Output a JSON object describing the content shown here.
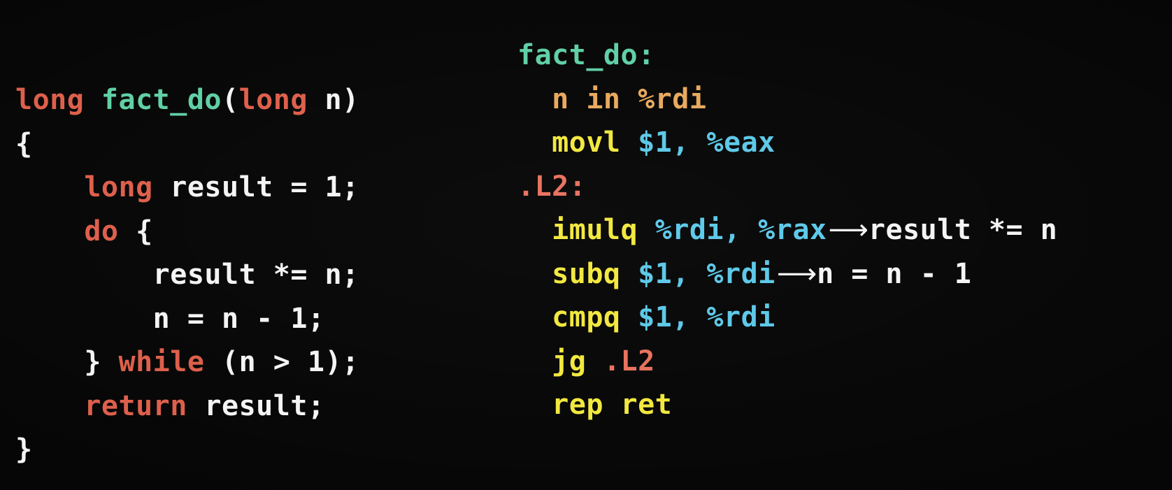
{
  "slide": {
    "background_color": "#050505",
    "palette": {
      "keyword_red": "#dd5e4a",
      "function_green": "#5ecfa4",
      "plain_white": "#f4f4f4",
      "mnemonic_yellow": "#f2e83c",
      "register_cyan": "#5bc8e8",
      "comment_orange": "#e8a85c",
      "label_red": "#e8705c"
    },
    "arrow_glyph": "⟶"
  },
  "c_code": {
    "lines": [
      {
        "id": "c-line-1",
        "tokens": [
          {
            "text": "long",
            "cls": "kw"
          },
          {
            "text": " ",
            "cls": "pl"
          },
          {
            "text": "fact_do",
            "cls": "fn"
          },
          {
            "text": "(",
            "cls": "pl"
          },
          {
            "text": "long",
            "cls": "kw"
          },
          {
            "text": " n)",
            "cls": "pl"
          }
        ]
      },
      {
        "id": "c-line-2",
        "tokens": [
          {
            "text": "{",
            "cls": "pl"
          }
        ]
      },
      {
        "id": "c-line-3",
        "tokens": [
          {
            "text": "    ",
            "cls": "pl"
          },
          {
            "text": "long",
            "cls": "kw"
          },
          {
            "text": " result = 1;",
            "cls": "pl"
          }
        ]
      },
      {
        "id": "c-line-4",
        "tokens": [
          {
            "text": "    ",
            "cls": "pl"
          },
          {
            "text": "do",
            "cls": "kw"
          },
          {
            "text": " {",
            "cls": "pl"
          }
        ]
      },
      {
        "id": "c-line-5",
        "tokens": [
          {
            "text": "        result *= n;",
            "cls": "pl"
          }
        ]
      },
      {
        "id": "c-line-6",
        "tokens": [
          {
            "text": "        n = n - 1;",
            "cls": "pl"
          }
        ]
      },
      {
        "id": "c-line-7",
        "tokens": [
          {
            "text": "    } ",
            "cls": "pl"
          },
          {
            "text": "while",
            "cls": "kw"
          },
          {
            "text": " (n > 1);",
            "cls": "pl"
          }
        ]
      },
      {
        "id": "c-line-8",
        "tokens": [
          {
            "text": "    ",
            "cls": "pl"
          },
          {
            "text": "return",
            "cls": "kw"
          },
          {
            "text": " result;",
            "cls": "pl"
          }
        ]
      },
      {
        "id": "c-line-9",
        "tokens": [
          {
            "text": "}",
            "cls": "pl"
          }
        ]
      }
    ]
  },
  "asm_code": {
    "lines": [
      {
        "id": "asm-line-1",
        "tokens": [
          {
            "text": "fact_do:",
            "cls": "fn"
          }
        ]
      },
      {
        "id": "asm-line-2",
        "tokens": [
          {
            "text": "  ",
            "cls": "pl"
          },
          {
            "text": "n in %rdi",
            "cls": "cmt"
          }
        ]
      },
      {
        "id": "asm-line-3",
        "tokens": [
          {
            "text": "  ",
            "cls": "pl"
          },
          {
            "text": "movl",
            "cls": "mn"
          },
          {
            "text": " ",
            "cls": "pl"
          },
          {
            "text": "$1, %eax",
            "cls": "reg"
          }
        ]
      },
      {
        "id": "asm-line-4",
        "tokens": [
          {
            "text": ".L2:",
            "cls": "lbl"
          }
        ]
      },
      {
        "id": "asm-line-5",
        "tokens": [
          {
            "text": "  ",
            "cls": "pl"
          },
          {
            "text": "imulq",
            "cls": "mn"
          },
          {
            "text": " ",
            "cls": "pl"
          },
          {
            "text": "%rdi, %rax",
            "cls": "reg"
          },
          {
            "text": "⟶",
            "cls": "arrow"
          },
          {
            "text": "result *= n",
            "cls": "ann"
          }
        ]
      },
      {
        "id": "asm-line-6",
        "tokens": [
          {
            "text": "  ",
            "cls": "pl"
          },
          {
            "text": "subq",
            "cls": "mn"
          },
          {
            "text": " ",
            "cls": "pl"
          },
          {
            "text": "$1, %rdi",
            "cls": "reg"
          },
          {
            "text": "⟶",
            "cls": "arrow"
          },
          {
            "text": "n = n - 1",
            "cls": "ann"
          }
        ]
      },
      {
        "id": "asm-line-7",
        "tokens": [
          {
            "text": "  ",
            "cls": "pl"
          },
          {
            "text": "cmpq",
            "cls": "mn"
          },
          {
            "text": " ",
            "cls": "pl"
          },
          {
            "text": "$1, %rdi",
            "cls": "reg"
          }
        ]
      },
      {
        "id": "asm-line-8",
        "tokens": [
          {
            "text": "  ",
            "cls": "pl"
          },
          {
            "text": "jg",
            "cls": "mn"
          },
          {
            "text": " ",
            "cls": "pl"
          },
          {
            "text": ".L2",
            "cls": "lbl"
          }
        ]
      },
      {
        "id": "asm-line-9",
        "tokens": [
          {
            "text": "  ",
            "cls": "pl"
          },
          {
            "text": "rep ret",
            "cls": "mn"
          }
        ]
      }
    ]
  }
}
